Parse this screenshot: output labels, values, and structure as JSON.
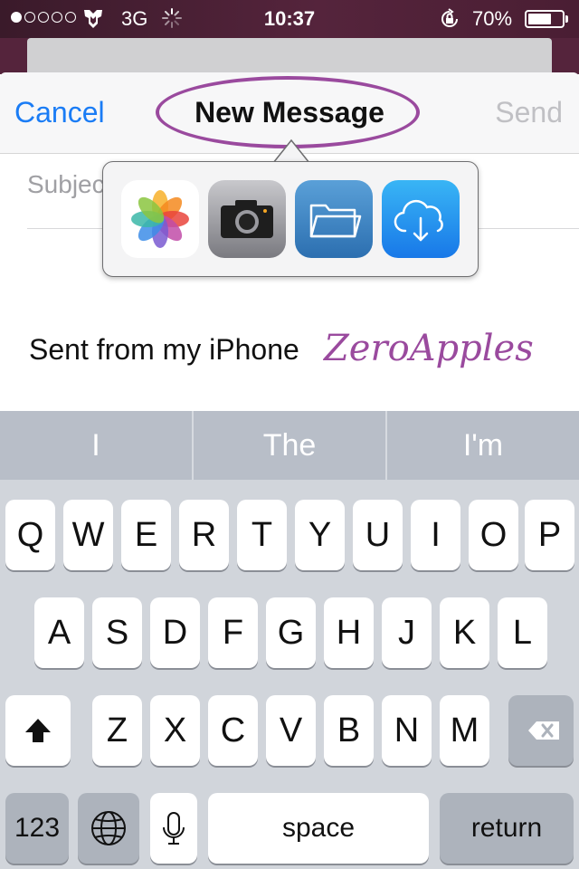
{
  "status_bar": {
    "signal_dots": [
      true,
      false,
      false,
      false,
      false
    ],
    "carrier_icon": "transformers-logo-icon",
    "network": "3G",
    "activity_icon": "spinner-icon",
    "time": "10:37",
    "rotation_lock_icon": "rotation-lock-icon",
    "battery_percent": "70%",
    "battery_level": 0.7
  },
  "nav": {
    "cancel_label": "Cancel",
    "title": "New Message",
    "send_label": "Send"
  },
  "compose": {
    "subject_label": "Subject",
    "body": "Sent from my iPhone",
    "watermark": "ZeroApples"
  },
  "popover": {
    "icons": [
      "photos-icon",
      "camera-icon",
      "folder-icon",
      "icloud-download-icon"
    ]
  },
  "keyboard": {
    "suggestions": [
      "I",
      "The",
      "I'm"
    ],
    "row1": [
      "Q",
      "W",
      "E",
      "R",
      "T",
      "Y",
      "U",
      "I",
      "O",
      "P"
    ],
    "row2": [
      "A",
      "S",
      "D",
      "F",
      "G",
      "H",
      "J",
      "K",
      "L"
    ],
    "row3": [
      "Z",
      "X",
      "C",
      "V",
      "B",
      "N",
      "M"
    ],
    "numbers_label": "123",
    "space_label": "space",
    "return_label": "return",
    "shift_icon": "shift-icon",
    "delete_icon": "backspace-icon",
    "globe_icon": "globe-icon",
    "mic_icon": "microphone-icon"
  }
}
